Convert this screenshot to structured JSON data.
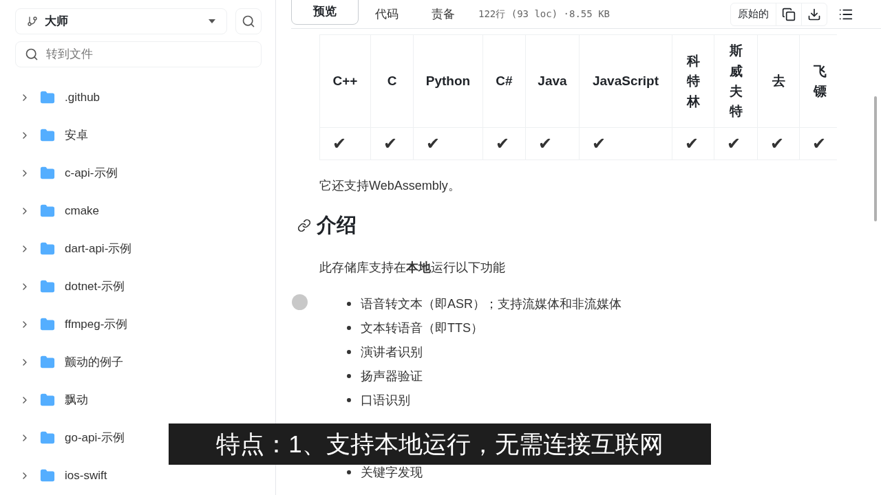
{
  "sidebar": {
    "branch": "大师",
    "file_search": {
      "placeholder": "转到文件"
    },
    "tree": [
      {
        "name": ".github",
        "expanded": false
      },
      {
        "name": "安卓",
        "expanded": false
      },
      {
        "name": "c-api-示例",
        "expanded": false
      },
      {
        "name": "cmake",
        "expanded": false
      },
      {
        "name": "dart-api-示例",
        "expanded": false
      },
      {
        "name": "dotnet-示例",
        "expanded": false
      },
      {
        "name": "ffmpeg-示例",
        "expanded": false
      },
      {
        "name": "颤动的例子",
        "expanded": false
      },
      {
        "name": "飘动",
        "expanded": false
      },
      {
        "name": "go-api-示例",
        "expanded": false
      },
      {
        "name": "ios-swift",
        "expanded": false
      }
    ]
  },
  "toolbar": {
    "tabs": [
      {
        "label": "预览",
        "selected": true
      },
      {
        "label": "代码",
        "selected": false
      },
      {
        "label": "责备",
        "selected": false
      }
    ],
    "file_info": "122行 (93 loc) ·8.55 KB",
    "raw_button": "原始的"
  },
  "table": {
    "columns": [
      {
        "label": "C++",
        "vertical": false,
        "cell": "✔"
      },
      {
        "label": "C",
        "vertical": false,
        "cell": "✔"
      },
      {
        "label": "Python",
        "vertical": false,
        "cell": "✔"
      },
      {
        "label": "C#",
        "vertical": false,
        "cell": "✔"
      },
      {
        "label": "Java",
        "vertical": false,
        "cell": "✔"
      },
      {
        "label": "JavaScript",
        "vertical": false,
        "cell": "✔"
      },
      {
        "label": "科特林",
        "vertical": true,
        "cell": "✔"
      },
      {
        "label": "斯威夫特",
        "vertical": true,
        "cell": "✔"
      },
      {
        "label": "去",
        "vertical": false,
        "cell": "✔"
      },
      {
        "label": "飞镖",
        "vertical": true,
        "cell": "✔"
      }
    ]
  },
  "note": "它还支持WebAssembly。",
  "heading": "介绍",
  "intro": "此存储库支持在**本地**运行以下功能",
  "features": [
    "语音转文本（即ASR）；支持流媒体和非流媒体",
    "文本转语音（即TTS）",
    "演讲者识别",
    "扬声器验证",
    "口语识别"
  ],
  "features_after": [
    "关键字发现"
  ],
  "subtitle": "特点：1、支持本地运行，无需连接互联网"
}
